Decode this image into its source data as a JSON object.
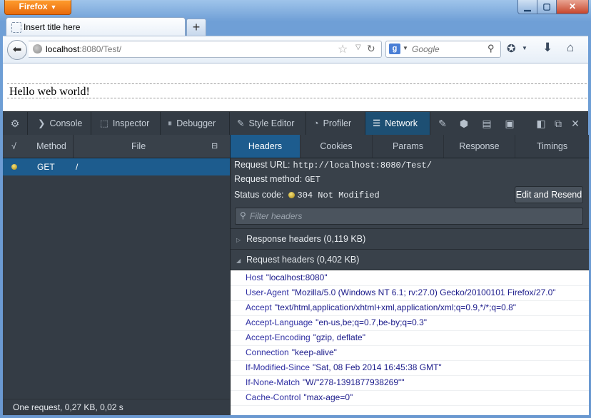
{
  "window": {
    "app_button": "Firefox"
  },
  "tab": {
    "title": "Insert title here",
    "new_tab": "+"
  },
  "navbar": {
    "url_host": "localhost",
    "url_rest": ":8080/Test/",
    "search_placeholder": "Google"
  },
  "page": {
    "text": "Hello web world!"
  },
  "devtools": {
    "tools": [
      "Console",
      "Inspector",
      "Debugger",
      "Style Editor",
      "Profiler",
      "Network"
    ],
    "active_tool": "Network",
    "request_columns": {
      "status": "√",
      "method": "Method",
      "file": "File"
    },
    "request": {
      "method": "GET",
      "file": "/"
    },
    "footer": "One request, 0,27 KB, 0,02 s",
    "detail_tabs": [
      "Headers",
      "Cookies",
      "Params",
      "Response",
      "Timings"
    ],
    "active_detail_tab": "Headers",
    "summary": {
      "url_label": "Request URL:",
      "url_value": "http://localhost:8080/Test/",
      "method_label": "Request method:",
      "method_value": "GET",
      "status_label": "Status code:",
      "status_value": "304 Not Modified"
    },
    "edit_resend": "Edit and Resend",
    "filter_placeholder": "Filter headers",
    "response_headers": "Response headers (0,119 KB)",
    "request_headers": "Request headers (0,402 KB)",
    "headers": [
      {
        "name": "Host",
        "value": "\"localhost:8080\""
      },
      {
        "name": "User-Agent",
        "value": "\"Mozilla/5.0 (Windows NT 6.1; rv:27.0) Gecko/20100101 Firefox/27.0\""
      },
      {
        "name": "Accept",
        "value": "\"text/html,application/xhtml+xml,application/xml;q=0.9,*/*;q=0.8\""
      },
      {
        "name": "Accept-Language",
        "value": "\"en-us,be;q=0.7,be-by;q=0.3\""
      },
      {
        "name": "Accept-Encoding",
        "value": "\"gzip, deflate\""
      },
      {
        "name": "Connection",
        "value": "\"keep-alive\""
      },
      {
        "name": "If-Modified-Since",
        "value": "\"Sat, 08 Feb 2014 16:45:38 GMT\""
      },
      {
        "name": "If-None-Match",
        "value": "\"W/\"278-1391877938269\"\""
      },
      {
        "name": "Cache-Control",
        "value": "\"max-age=0\""
      }
    ]
  },
  "colors": {
    "accent": "#1d5c8e",
    "devtools_bg": "#343c45",
    "header_name": "#2f2fa3"
  }
}
